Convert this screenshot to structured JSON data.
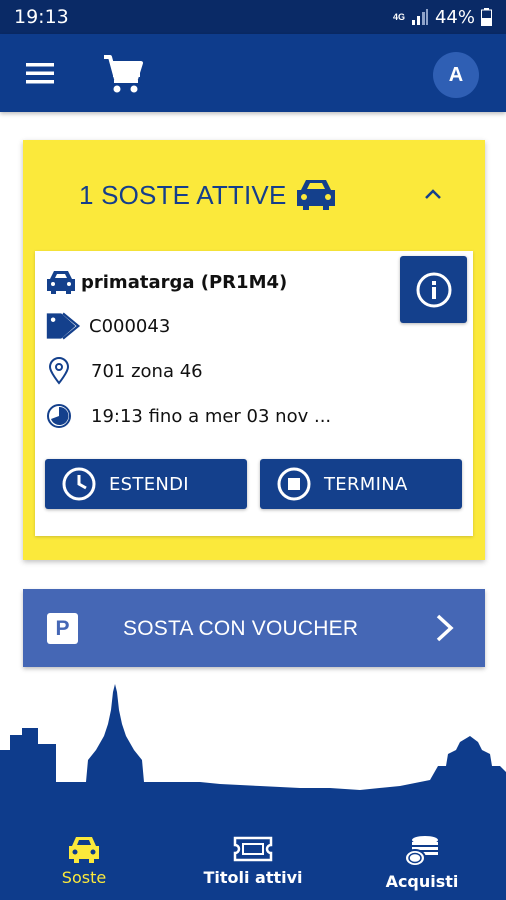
{
  "status_bar": {
    "time": "19:13",
    "network": "4G",
    "battery": "44%"
  },
  "app_bar": {
    "avatar_initial": "A"
  },
  "active_parkings": {
    "title": "1 SOSTE ATTIVE",
    "plate": "primatarga (PR1M4)",
    "code": "C000043",
    "zone": "701 zona 46",
    "time": "19:13 fino a mer 03 nov ...",
    "extend_label": "ESTENDI",
    "end_label": "TERMINA"
  },
  "voucher": {
    "badge": "P",
    "label": "SOSTA CON VOUCHER"
  },
  "bottom_nav": {
    "items": [
      {
        "label": "Soste",
        "icon": "car-icon",
        "active": true
      },
      {
        "label": "Titoli attivi",
        "icon": "ticket-icon",
        "active": false
      },
      {
        "label": "Acquisti",
        "icon": "coins-icon",
        "active": false
      }
    ]
  },
  "colors": {
    "primary": "#0e3c8c",
    "button": "#14408c",
    "accent_yellow": "#fbe93b",
    "voucher": "#4567b5"
  }
}
